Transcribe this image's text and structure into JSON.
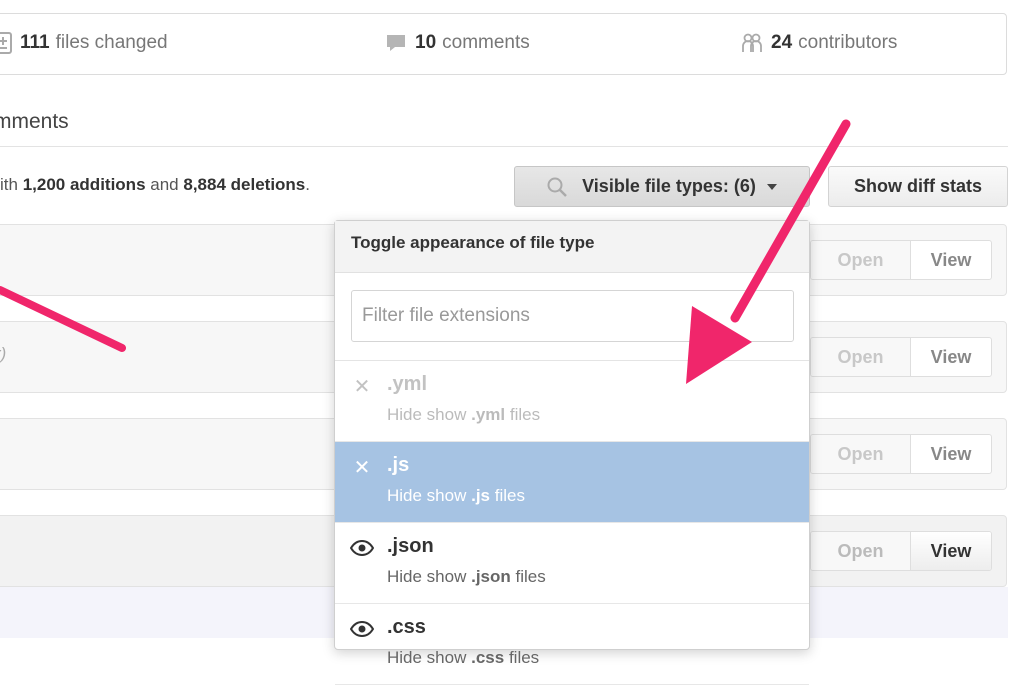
{
  "summary": {
    "files_count": "111",
    "files_label": "files changed",
    "comments_count": "10",
    "comments_label": "comments",
    "contributors_count": "24",
    "contributors_label": "contributors"
  },
  "section": {
    "title": "mments"
  },
  "diff": {
    "prefix": "ith",
    "additions": "1,200 additions",
    "and": "and",
    "deletions": "8,884 deletions",
    "suffix": "."
  },
  "toolbar": {
    "file_types_label": "Visible file types: (6)",
    "diff_stats_label": "Show diff stats"
  },
  "file_rows": [
    {
      "open": "Open",
      "view": "View"
    },
    {
      "open": "Open",
      "view": "View",
      "fragment": "r)"
    },
    {
      "open": "Open",
      "view": "View"
    },
    {
      "open": "Open",
      "view": "View"
    }
  ],
  "dropdown": {
    "title": "Toggle appearance of file type",
    "filter_placeholder": "Filter file extensions",
    "items": [
      {
        "ext": ".yml",
        "desc_pre": "Hide show",
        "desc_ext": ".yml",
        "desc_post": "files",
        "state": "hidden",
        "icon": "x-icon"
      },
      {
        "ext": ".js",
        "desc_pre": "Hide show",
        "desc_ext": ".js",
        "desc_post": "files",
        "state": "selected",
        "icon": "x-icon"
      },
      {
        "ext": ".json",
        "desc_pre": "Hide show",
        "desc_ext": ".json",
        "desc_post": "files",
        "state": "visible",
        "icon": "eye-icon"
      },
      {
        "ext": ".css",
        "desc_pre": "Hide show",
        "desc_ext": ".css",
        "desc_post": "files",
        "state": "visible",
        "icon": "eye-icon"
      }
    ]
  },
  "colors": {
    "arrow": "#f0266b",
    "selected_row": "#a6c3e3"
  }
}
